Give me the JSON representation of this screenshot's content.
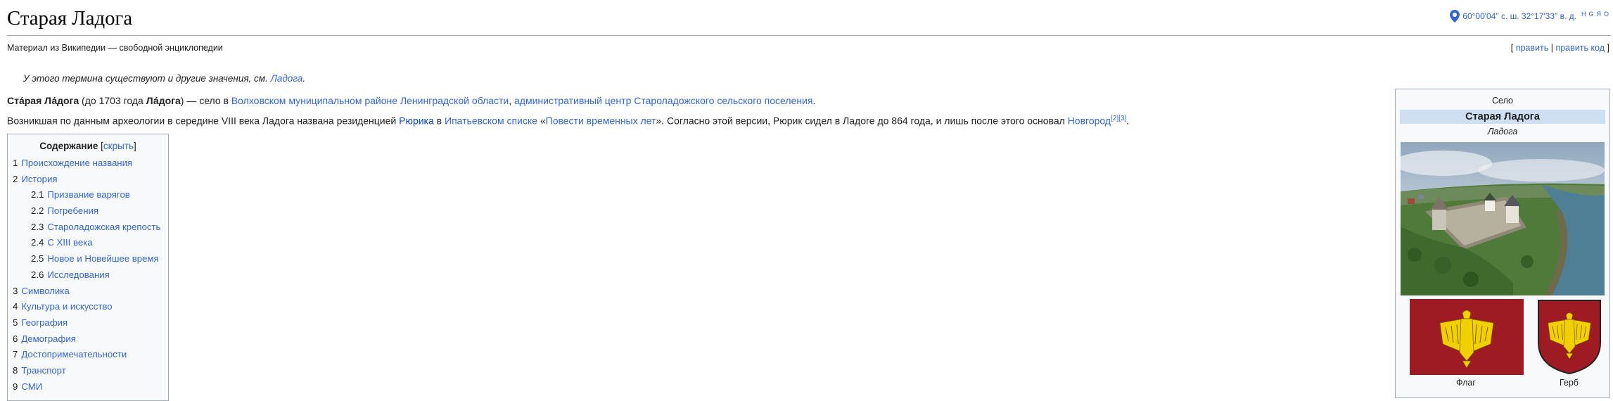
{
  "article": {
    "title": "Старая Ладога",
    "site_sub": "Материал из Википедии — свободной энциклопедии",
    "coordinates": {
      "text": "60°00′04″ с. ш. 32°17′33″ в. д.",
      "maplinks": [
        "H",
        "G",
        "Я",
        "O"
      ]
    },
    "edit_links": {
      "open_bracket": "[ ",
      "edit": "править",
      "sep": " | ",
      "edit_source": "править код",
      "close_bracket": " ]"
    },
    "hatnote": {
      "text": "У этого термина существуют и другие значения, см. ",
      "link": "Ладога",
      "end": "."
    },
    "lead": {
      "bold1": "Ста́рая Ла́дога",
      "t1": " (до 1703 года ",
      "bold2": "Ла́дога",
      "t2": ") — село в ",
      "link1": "Волховском муниципальном районе",
      "t3": " ",
      "link2": "Ленинградской области",
      "t4": ", ",
      "link3": "административный центр",
      "t5": " ",
      "link4": "Староладожского сельского поселения",
      "t6": "."
    },
    "para2": {
      "t1": "Возникшая по данным археологии в середине VIII века Ладога названа резиденцией ",
      "link1": "Рюрика",
      "t2": " в ",
      "link2": "Ипатьевском списке",
      "t3": " «",
      "link3": "Повести временных лет",
      "t4": "». Согласно этой версии, Рюрик сидел в Ладоге до 864 года, и лишь после этого основал ",
      "link4": "Новгород",
      "ref1": "[2]",
      "ref2": "[3]",
      "t5": "."
    }
  },
  "toc": {
    "title": "Содержание",
    "toggle_open": " [",
    "toggle": "скрыть",
    "toggle_close": "]",
    "items": [
      {
        "num": "1",
        "label": "Происхождение названия",
        "level": 1
      },
      {
        "num": "2",
        "label": "История",
        "level": 1
      },
      {
        "num": "2.1",
        "label": "Призвание варягов",
        "level": 2
      },
      {
        "num": "2.2",
        "label": "Погребения",
        "level": 2
      },
      {
        "num": "2.3",
        "label": "Староладожская крепость",
        "level": 2
      },
      {
        "num": "2.4",
        "label": "С XIII века",
        "level": 2
      },
      {
        "num": "2.5",
        "label": "Новое и Новейшее время",
        "level": 2
      },
      {
        "num": "2.6",
        "label": "Исследования",
        "level": 2
      },
      {
        "num": "3",
        "label": "Символика",
        "level": 1
      },
      {
        "num": "4",
        "label": "Культура и искусство",
        "level": 1
      },
      {
        "num": "5",
        "label": "География",
        "level": 1
      },
      {
        "num": "6",
        "label": "Демография",
        "level": 1
      },
      {
        "num": "7",
        "label": "Достопримечательности",
        "level": 1
      },
      {
        "num": "8",
        "label": "Транспорт",
        "level": 1
      },
      {
        "num": "9",
        "label": "СМИ",
        "level": 1
      }
    ]
  },
  "infobox": {
    "type": "Село",
    "name": "Старая Ладога",
    "alt_name": "Ладога",
    "flag_caption": "Флаг",
    "coa_caption": "Герб"
  },
  "colors": {
    "link": "#3366cc",
    "infobox_header": "#cedff2",
    "flag_red": "#9e1b23",
    "bird_gold": "#f2d000"
  }
}
